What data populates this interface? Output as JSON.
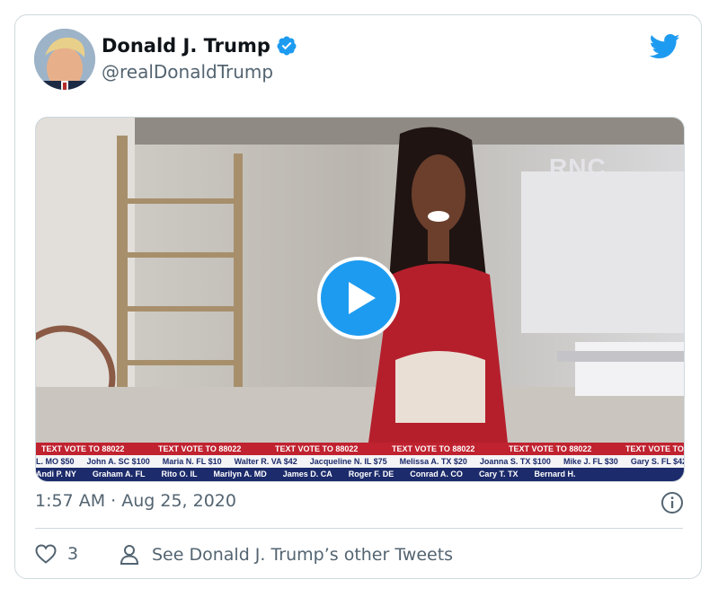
{
  "author": {
    "display_name": "Donald J. Trump",
    "handle": "@realDonaldTrump",
    "verified": true
  },
  "media": {
    "watermark": "RNC",
    "ticker": {
      "top_row": [
        "TEXT VOTE TO 88022",
        "TEXT VOTE TO 88022",
        "TEXT VOTE TO 88022",
        "TEXT VOTE TO 88022",
        "TEXT VOTE TO 88022",
        "TEXT VOTE TO"
      ],
      "middle_row": [
        "L. MO $50",
        "John A. SC $100",
        "Maria N. FL $10",
        "Walter R. VA $42",
        "Jacqueline N. IL $75",
        "Melissa A. TX $20",
        "Joanna S. TX $100",
        "Mike J. FL $30",
        "Gary S. FL $42"
      ],
      "bottom_row": [
        "Andi P. NY",
        "Graham A. FL",
        "Rito O. IL",
        "Marilyn A. MD",
        "James D. CA",
        "Roger F. DE",
        "Conrad A. CO",
        "Cary T. TX",
        "Bernard H."
      ]
    }
  },
  "timestamp": "1:57 AM · Aug 25, 2020",
  "actions": {
    "like_count": "3",
    "other_tweets_label": "See Donald J. Trump’s other Tweets"
  },
  "colors": {
    "accent": "#1d9bf0",
    "secondary_text": "#536471",
    "border": "#cfd9de"
  },
  "icons": [
    "twitter-bird-icon",
    "verified-badge-icon",
    "play-icon",
    "info-icon",
    "heart-icon",
    "person-icon"
  ]
}
